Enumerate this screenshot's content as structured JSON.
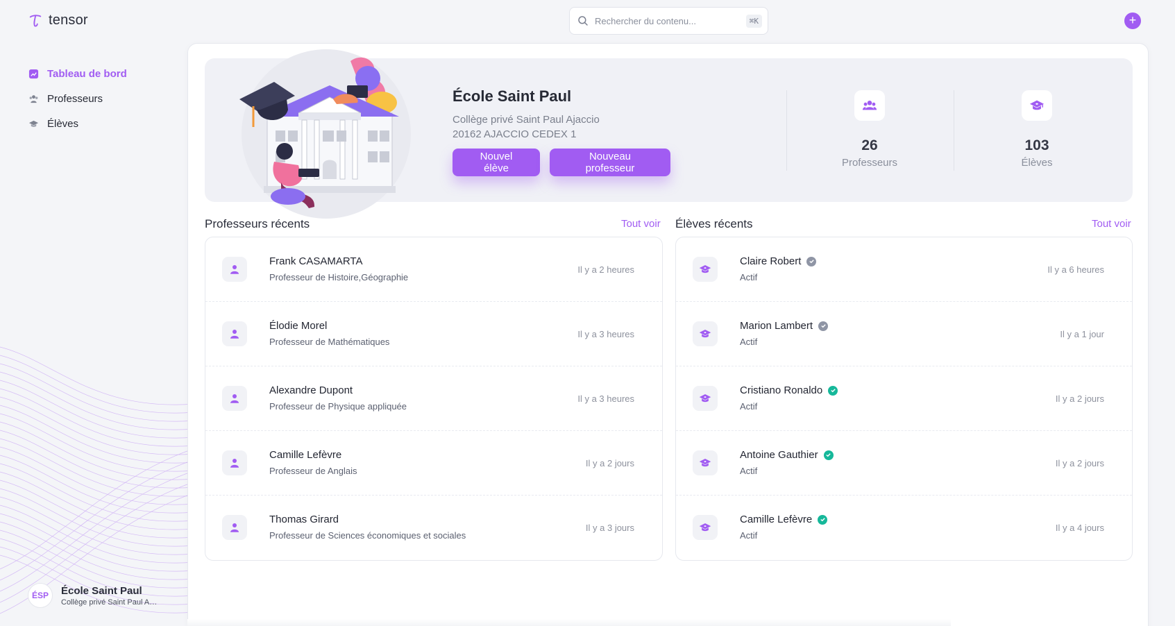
{
  "brand": {
    "name": "tensor",
    "accent": "#a15cf2"
  },
  "search": {
    "placeholder": "Rechercher du contenu...",
    "shortcut": "⌘K"
  },
  "header": {
    "add_icon": "plus-icon",
    "add_label": "+"
  },
  "sidebar": {
    "items": [
      {
        "label": "Tableau de bord",
        "icon": "dashboard-icon",
        "active": true
      },
      {
        "label": "Professeurs",
        "icon": "users-icon",
        "active": false
      },
      {
        "label": "Élèves",
        "icon": "graduation-cap-icon",
        "active": false
      }
    ],
    "school": {
      "initials": "ÉSP",
      "name": "École Saint Paul",
      "subtitle": "Collège privé Saint Paul Ajaccio"
    }
  },
  "hero": {
    "title": "École Saint Paul",
    "line1": "Collège privé Saint Paul Ajaccio",
    "line2": "20162 AJACCIO CEDEX 1",
    "new_student_label": "Nouvel élève",
    "new_teacher_label": "Nouveau professeur",
    "stats": [
      {
        "value": "26",
        "label": "Professeurs",
        "icon": "users-icon"
      },
      {
        "value": "103",
        "label": "Élèves",
        "icon": "graduation-cap-icon"
      }
    ]
  },
  "teachers": {
    "title": "Professeurs récents",
    "see_all": "Tout voir",
    "rows": [
      {
        "name": "Frank CASAMARTA",
        "subtitle": "Professeur de Histoire,Géographie",
        "time": "Il y a 2 heures"
      },
      {
        "name": "Élodie Morel",
        "subtitle": "Professeur de Mathématiques",
        "time": "Il y a 3 heures"
      },
      {
        "name": "Alexandre Dupont",
        "subtitle": "Professeur de Physique appliquée",
        "time": "Il y a 3 heures"
      },
      {
        "name": "Camille Lefèvre",
        "subtitle": "Professeur de Anglais",
        "time": "Il y a 2 jours"
      },
      {
        "name": "Thomas Girard",
        "subtitle": "Professeur de Sciences économiques et sociales",
        "time": "Il y a 3 jours"
      }
    ]
  },
  "students": {
    "title": "Élèves récents",
    "see_all": "Tout voir",
    "rows": [
      {
        "name": "Claire Robert",
        "subtitle": "Actif",
        "time": "Il y a 6 heures",
        "verified": "grey"
      },
      {
        "name": "Marion Lambert",
        "subtitle": "Actif",
        "time": "Il y a 1 jour",
        "verified": "grey"
      },
      {
        "name": "Cristiano Ronaldo",
        "subtitle": "Actif",
        "time": "Il y a 2 jours",
        "verified": "green"
      },
      {
        "name": "Antoine Gauthier",
        "subtitle": "Actif",
        "time": "Il y a 2 jours",
        "verified": "green"
      },
      {
        "name": "Camille Lefèvre",
        "subtitle": "Actif",
        "time": "Il y a 4 jours",
        "verified": "green"
      }
    ]
  }
}
